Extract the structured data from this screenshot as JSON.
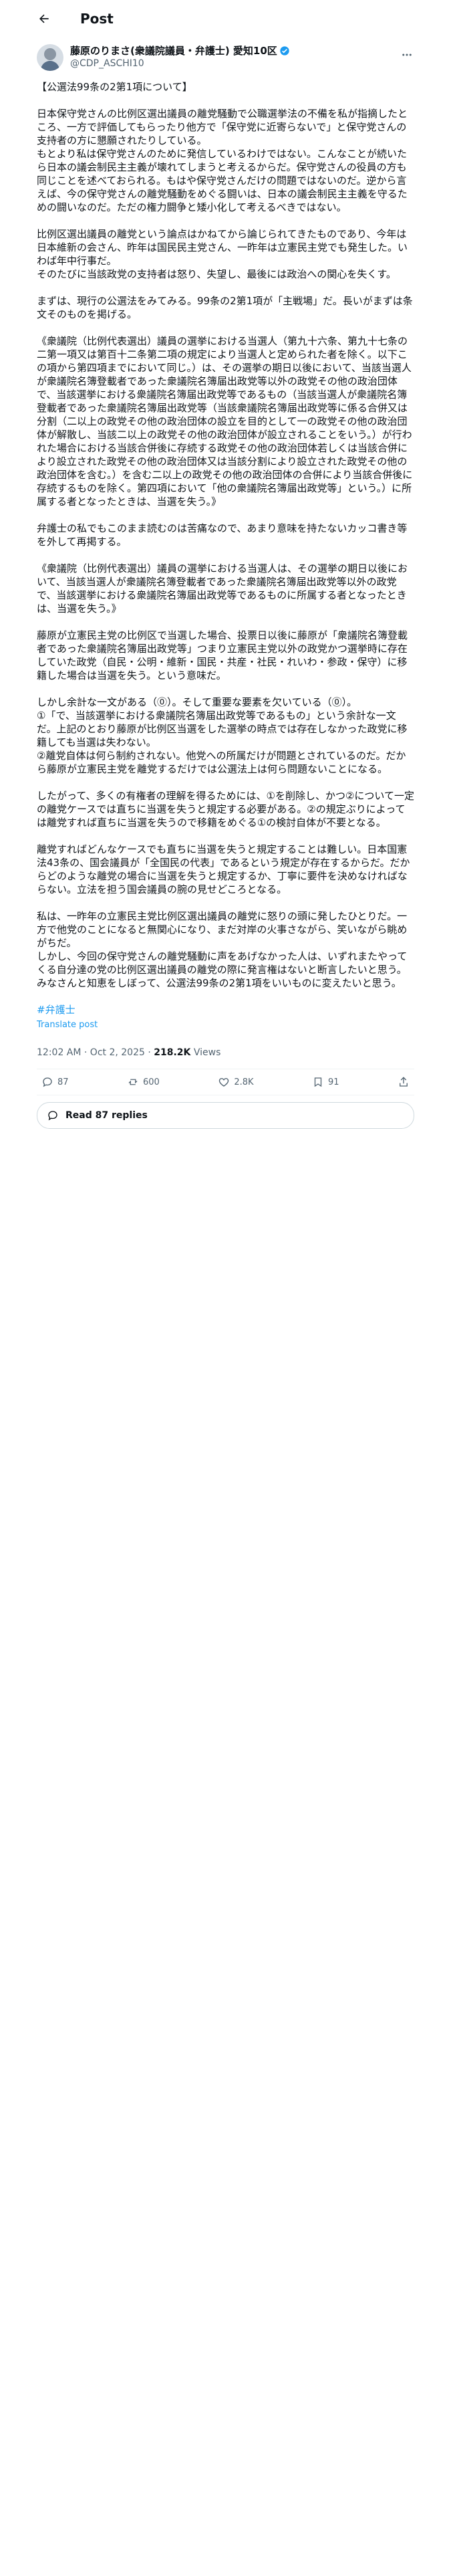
{
  "topbar": {
    "title": "Post"
  },
  "author": {
    "name": "藤原のりまさ(衆議院議員・弁護士) 愛知10区",
    "handle": "@CDP_ASCHI10"
  },
  "post": {
    "paragraphs": [
      "【公選法99条の2第1項について】",
      "日本保守党さんの比例区選出議員の離党騒動で公職選挙法の不備を私が指摘したところ、一方で評価してもらったり他方で「保守党に近寄らないで」と保守党さんの支持者の方に懇願されたりしている。\nもとより私は保守党さんのために発信しているわけではない。こんなことが続いたら日本の議会制民主主義が壊れてしまうと考えるからだ。保守党さんの役員の方も同じことを述べておられる。もはや保守党さんだけの問題ではないのだ。逆から言えば、今の保守党さんの離党騒動をめぐる闘いは、日本の議会制民主主義を守るための闘いなのだ。ただの権力闘争と矮小化して考えるべきではない。",
      "比例区選出議員の離党という論点はかねてから論じられてきたものであり、今年は日本維新の会さん、昨年は国民民主党さん、一昨年は立憲民主党でも発生した。いわば年中行事だ。\nそのたびに当該政党の支持者は怒り、失望し、最後には政治への関心を失くす。",
      "まずは、現行の公選法をみてみる。99条の2第1項が「主戦場」だ。長いがまずは条文そのものを掲げる。",
      "《衆議院（比例代表選出）議員の選挙における当選人（第九十六条、第九十七条の二第一項又は第百十二条第二項の規定により当選人と定められた者を除く。以下この項から第四項までにおいて同じ。）は、その選挙の期日以後において、当該当選人が衆議院名簿登載者であった衆議院名簿届出政党等以外の政党その他の政治団体で、当該選挙における衆議院名簿届出政党等であるもの（当該当選人が衆議院名簿登載者であった衆議院名簿届出政党等（当該衆議院名簿届出政党等に係る合併又は分割（二以上の政党その他の政治団体の設立を目的として一の政党その他の政治団体が解散し、当該二以上の政党その他の政治団体が設立されることをいう。）が行われた場合における当該合併後に存続する政党その他の政治団体若しくは当該合併により設立された政党その他の政治団体又は当該分割により設立された政党その他の政治団体を含む。）を含む二以上の政党その他の政治団体の合併により当該合併後に存続するものを除く。第四項において「他の衆議院名簿届出政党等」という。）に所属する者となったときは、当選を失う。》",
      "弁護士の私でもこのまま読むのは苦痛なので、あまり意味を持たないカッコ書き等を外して再掲する。",
      "《衆議院（比例代表選出）議員の選挙における当選人は、その選挙の期日以後において、当該当選人が衆議院名簿登載者であった衆議院名簿届出政党等以外の政党で、当該選挙における衆議院名簿届出政党等であるものに所属する者となったときは、当選を失う。》",
      "藤原が立憲民主党の比例区で当選した場合、投票日以後に藤原が「衆議院名簿登載者であった衆議院名簿届出政党等」つまり立憲民主党以外の政党かつ選挙時に存在していた政党（自民・公明・維新・国民・共産・社民・れいわ・参政・保守）に移籍した場合は当選を失う。という意味だ。",
      "しかし余計な一文がある（⓪）。そして重要な要素を欠いている（⓪）。\n①「で、当該選挙における衆議院名簿届出政党等であるもの」という余計な一文だ。上記のとおり藤原が比例区当選をした選挙の時点では存在しなかった政党に移籍しても当選は失わない。\n②離党自体は何ら制約されない。他党への所属だけが問題とされているのだ。だから藤原が立憲民主党を離党するだけでは公選法上は何ら問題ないことになる。",
      "したがって、多くの有権者の理解を得るためには、①を削除し、かつ②について一定の離党ケースでは直ちに当選を失うと規定する必要がある。②の規定ぶりによっては離党すれば直ちに当選を失うので移籍をめぐる①の検討自体が不要となる。",
      "離党すればどんなケースでも直ちに当選を失うと規定することは難しい。日本国憲法43条の、国会議員が「全国民の代表」であるという規定が存在するからだ。だからどのような離党の場合に当選を失うと規定するか、丁寧に要件を決めなければならない。立法を担う国会議員の腕の見せどころとなる。",
      "私は、一昨年の立憲民主党比例区選出議員の離党に怒りの頭に発したひとりだ。一方で他党のことになると無関心になり、まだ対岸の火事さながら、笑いながら眺めがちだ。\nしかし、今回の保守党さんの離党騒動に声をあげなかった人は、いずれまたやってくる自分達の党の比例区選出議員の離党の際に発言権はないと断言したいと思う。\nみなさんと知恵をしぼって、公選法99条の2第1項をいいものに変えたいと思う。"
    ],
    "hashtag": "#弁護士",
    "translate": "Translate post",
    "time": "12:02 AM · Oct 2, 2025 · ",
    "views_count": "218.2K",
    "views_label": " Views"
  },
  "actions": {
    "replies": "87",
    "reposts": "600",
    "likes": "2.8K",
    "bookmarks": "91"
  },
  "read_replies": "Read 87 replies",
  "colors": {
    "accent": "#1d9bf0",
    "text": "#0f1419",
    "muted": "#536471"
  }
}
